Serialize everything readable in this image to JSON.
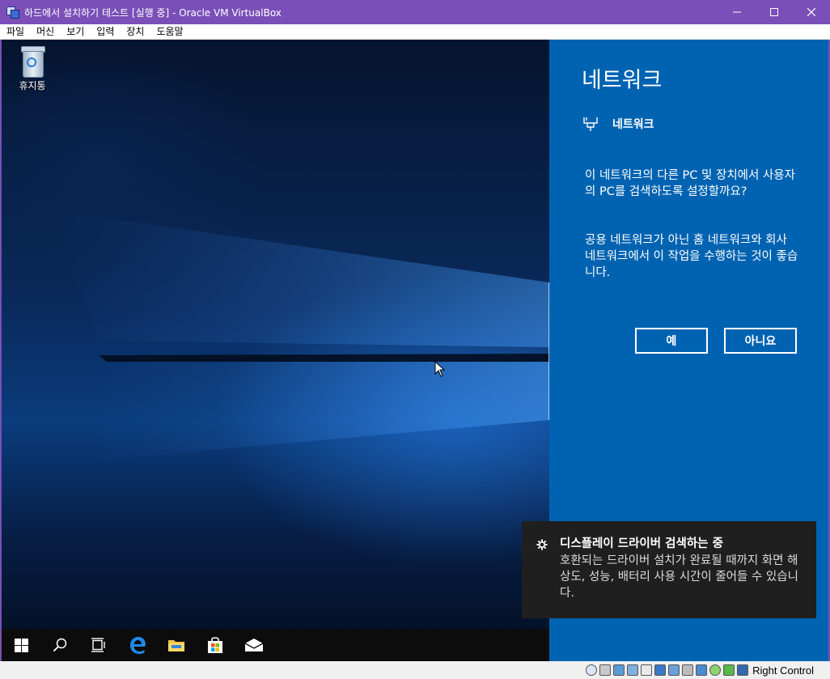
{
  "window": {
    "title": "하드에서 설치하기 테스트 [실행 중] - Oracle VM VirtualBox"
  },
  "menu": [
    "파일",
    "머신",
    "보기",
    "입력",
    "장치",
    "도움말"
  ],
  "desktop": {
    "recycle_bin_label": "휴지통"
  },
  "network_panel": {
    "title": "네트워크",
    "network_name": "네트워크",
    "question": "이 네트워크의 다른 PC 및 장치에서 사용자의 PC를 검색하도록 설정할까요?",
    "advice": "공용 네트워크가 아닌 홈 네트워크와 회사 네트워크에서 이 작업을 수행하는 것이 좋습니다.",
    "yes_label": "예",
    "no_label": "아니요",
    "background_color": "#0063b1"
  },
  "toast": {
    "title": "디스플레이 드라이버 검색하는 중",
    "body": "호환되는 드라이버 설치가 완료될 때까지 화면 해상도, 성능, 배터리 사용 시간이 줄어들 수 있습니다.",
    "icon": "gear-icon"
  },
  "taskbar": {
    "icons": [
      "start-icon",
      "search-icon",
      "task-view-icon",
      "edge-icon",
      "file-explorer-icon",
      "store-icon",
      "mail-icon"
    ]
  },
  "statusbar": {
    "host_key_label": "Right Control"
  }
}
